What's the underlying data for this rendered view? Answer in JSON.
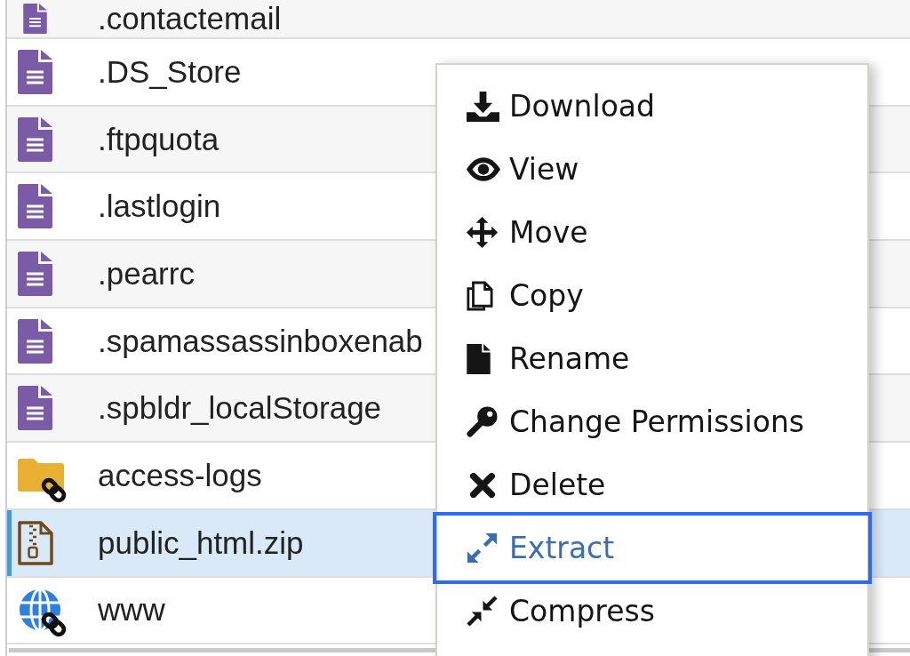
{
  "files": [
    {
      "name": ".contactemail",
      "kind": "document",
      "linked": false,
      "selected": false
    },
    {
      "name": ".DS_Store",
      "kind": "document",
      "linked": false,
      "selected": false
    },
    {
      "name": ".ftpquota",
      "kind": "document",
      "linked": false,
      "selected": false
    },
    {
      "name": ".lastlogin",
      "kind": "document",
      "linked": false,
      "selected": false
    },
    {
      "name": ".pearrc",
      "kind": "document",
      "linked": false,
      "selected": false
    },
    {
      "name": ".spamassassinboxenab",
      "kind": "document",
      "linked": false,
      "selected": false
    },
    {
      "name": ".spbldr_localStorage",
      "kind": "document",
      "linked": false,
      "selected": false
    },
    {
      "name": "access-logs",
      "kind": "folder",
      "linked": true,
      "selected": false
    },
    {
      "name": "public_html.zip",
      "kind": "archive",
      "linked": false,
      "selected": true
    },
    {
      "name": "www",
      "kind": "web",
      "linked": true,
      "selected": false
    }
  ],
  "context_menu": {
    "items": [
      {
        "label": "Download",
        "selected": false
      },
      {
        "label": "View",
        "selected": false
      },
      {
        "label": "Move",
        "selected": false
      },
      {
        "label": "Copy",
        "selected": false
      },
      {
        "label": "Rename",
        "selected": false
      },
      {
        "label": "Change Permissions",
        "selected": false
      },
      {
        "label": "Delete",
        "selected": false
      },
      {
        "label": "Extract",
        "selected": true
      },
      {
        "label": "Compress",
        "selected": false
      }
    ]
  }
}
